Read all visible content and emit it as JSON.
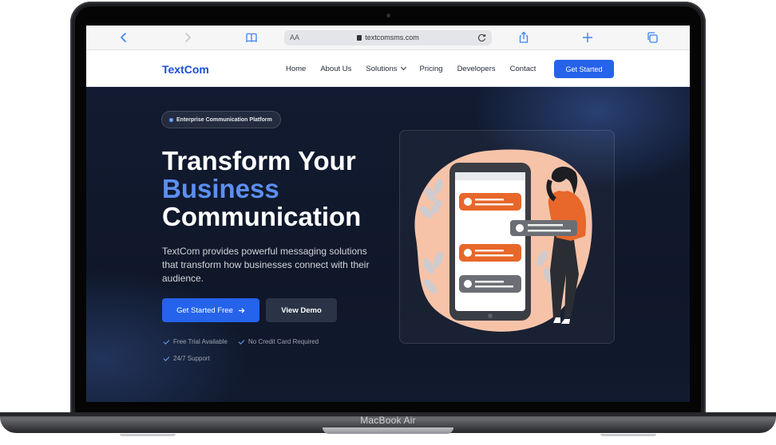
{
  "device": {
    "label": "MacBook Air"
  },
  "browser": {
    "text_size_label": "AA",
    "url": "textcomsms.com",
    "icons": [
      "back-icon",
      "forward-icon",
      "bookmarks-icon",
      "lock-icon",
      "reload-icon",
      "share-icon",
      "new-tab-icon",
      "tabs-icon"
    ]
  },
  "site": {
    "logo": "TextCom",
    "nav": {
      "home": "Home",
      "about": "About Us",
      "solutions": "Solutions",
      "pricing": "Pricing",
      "developers": "Developers",
      "contact": "Contact"
    },
    "nav_cta": "Get Started",
    "colors": {
      "accent": "#2563eb",
      "hero_bg": "#0f1729",
      "highlight": "#5b8ff0",
      "illustration_orange": "#e8672a",
      "illustration_peach": "#f6c3a9"
    }
  },
  "hero": {
    "badge": "Enterprise Communication Platform",
    "title_line1": "Transform Your",
    "title_line2": "Business",
    "title_line3": "Communication",
    "description": "TextCom provides powerful messaging solutions that transform how businesses connect with their audience.",
    "primary_button": "Get Started Free",
    "secondary_button": "View Demo",
    "features": [
      "Free Trial Available",
      "No Credit Card Required",
      "24/7 Support"
    ]
  }
}
